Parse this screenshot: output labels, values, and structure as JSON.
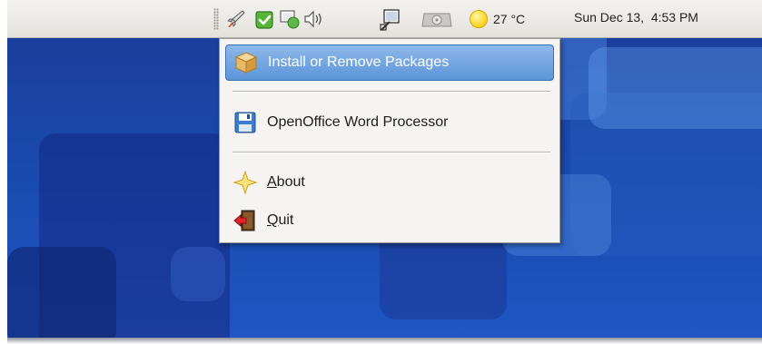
{
  "panel": {
    "tray_icons": [
      "rocket-icon",
      "update-notifier-icon",
      "network-icon",
      "volume-icon",
      "display-icon",
      "hard-drive-icon"
    ],
    "weather_icon": "sun-icon",
    "temperature": "27 °C",
    "clock": "Sun Dec 13,  4:53 PM"
  },
  "menu": {
    "items": [
      {
        "label": "Install or Remove Packages",
        "icon": "package-icon",
        "selected": true
      },
      {
        "label": "OpenOffice Word Processor",
        "icon": "floppy-disk-icon"
      },
      {
        "label_first": "A",
        "label_rest": "bout",
        "icon": "star-icon"
      },
      {
        "label_first": "Q",
        "label_rest": "uit",
        "icon": "exit-door-icon"
      }
    ]
  },
  "colors": {
    "selection": "#6fa3e0",
    "desktop": "#1c47a8",
    "panel": "#ebe9e5"
  }
}
